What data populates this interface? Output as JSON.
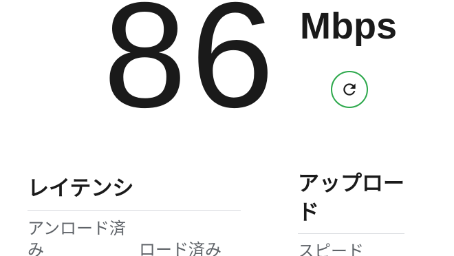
{
  "result": {
    "speed_value": "86",
    "speed_unit": "Mbps"
  },
  "refresh": {
    "icon": "refresh-icon",
    "color": "#2ca84b"
  },
  "latency": {
    "title": "レイテンシ",
    "unloaded_label": "アンロード済み",
    "loaded_label": "ロード済み"
  },
  "upload": {
    "title": "アップロード",
    "speed_label": "スピード"
  }
}
